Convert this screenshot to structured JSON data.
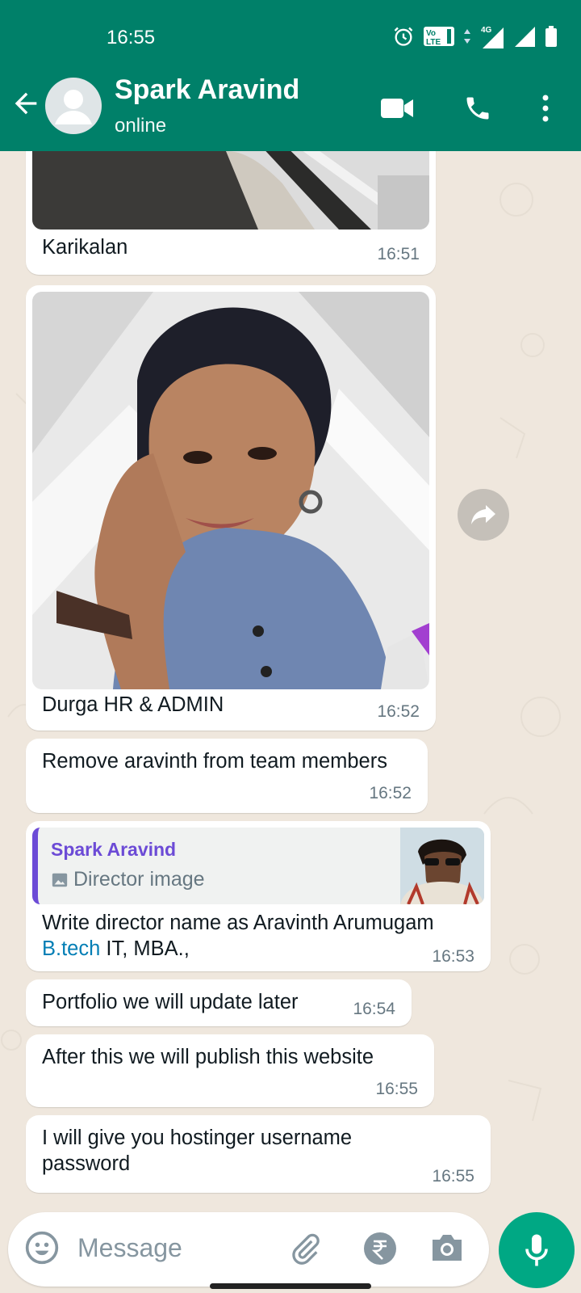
{
  "status_bar": {
    "time": "16:55",
    "volte_label": "Vo LTE",
    "network": "4G"
  },
  "header": {
    "contact_name": "Spark Aravind",
    "contact_status": "online",
    "icons": [
      "back-arrow-icon",
      "video-call-icon",
      "voice-call-icon",
      "more-options-icon"
    ]
  },
  "messages": [
    {
      "type": "image",
      "caption": "Karikalan",
      "time": "16:51"
    },
    {
      "type": "image",
      "caption": "Durga HR & ADMIN",
      "time": "16:52"
    },
    {
      "type": "text",
      "text": "Remove aravinth from team members",
      "time": "16:52"
    },
    {
      "type": "reply",
      "quote": {
        "sender": "Spark Aravind",
        "label": "Director image"
      },
      "text_line1": "Write director name as Aravinth Arumugam",
      "text_link": "B.tech",
      "text_rest": " IT, MBA.,",
      "time": "16:53"
    },
    {
      "type": "text",
      "text": "Portfolio we will update later",
      "time": "16:54"
    },
    {
      "type": "text",
      "text": "After this we will publish  this website",
      "time": "16:55"
    },
    {
      "type": "text",
      "text_line1": "I will give you hostinger username",
      "text_line2": "password",
      "time": "16:55"
    }
  ],
  "composer": {
    "placeholder": "Message"
  },
  "colors": {
    "header": "#008069",
    "accent": "#00a884",
    "chat_bg": "#efe7dd",
    "quote_accent": "#6c4bd6",
    "link": "#027eb5"
  }
}
